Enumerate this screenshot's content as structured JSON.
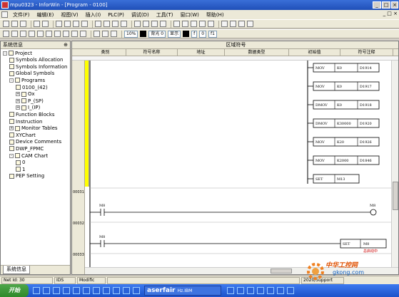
{
  "window": {
    "title": "mpu0323 - InforWin - [Program - 0100]",
    "controls": [
      "_",
      "□",
      "×"
    ]
  },
  "menu": {
    "items": [
      "文件(F)",
      "编辑(E)",
      "视图(V)",
      "插入(I)",
      "PLC(P)",
      "调试(D)",
      "工具(T)",
      "窗口(W)",
      "帮助(H)"
    ],
    "mdi_controls": "_ □ ×"
  },
  "toolbar2": {
    "combo1": "10",
    "combo2": "0",
    "label_step": "10%",
    "label_a": "背光 0",
    "label_b": "显示",
    "label_c": "f",
    "label_d": "0",
    "label_e": "f1"
  },
  "left_panel": {
    "title": "系统信息",
    "pin": "⊕",
    "tab": "系统信息",
    "tree": [
      {
        "label": "Project",
        "level": 0,
        "toggle": "-"
      },
      {
        "label": "Symbols Allocation",
        "level": 1
      },
      {
        "label": "Symbols Information",
        "level": 1
      },
      {
        "label": "Global Symbols",
        "level": 1
      },
      {
        "label": "Programs",
        "level": 1,
        "toggle": "-"
      },
      {
        "label": "0100_(42)",
        "level": 2
      },
      {
        "label": "Ox",
        "level": 2,
        "toggle": "+"
      },
      {
        "label": "P_(SP)",
        "level": 2,
        "toggle": "+"
      },
      {
        "label": "I_(IP)",
        "level": 2,
        "toggle": "+"
      },
      {
        "label": "Function Blocks",
        "level": 1
      },
      {
        "label": "Instruction",
        "level": 1
      },
      {
        "label": "Monitor Tables",
        "level": 1,
        "toggle": "+"
      },
      {
        "label": "XYChart",
        "level": 1
      },
      {
        "label": "Device Comments",
        "level": 1
      },
      {
        "label": "DWP_FPMC",
        "level": 1
      },
      {
        "label": "CAM Chart",
        "level": 1,
        "toggle": "-"
      },
      {
        "label": "0",
        "level": 2
      },
      {
        "label": "1",
        "level": 2
      },
      {
        "label": "PEP Setting",
        "level": 1
      }
    ]
  },
  "editor": {
    "header_title": "区域符号",
    "columns": [
      "类别",
      "符号名称",
      "地址",
      "数据类型",
      "初始值",
      "符号注释"
    ],
    "rung_numbers": [
      "00031",
      "00032",
      "00033"
    ],
    "instructions": [
      {
        "op": "MOV",
        "src": "K0",
        "dst": "D1914"
      },
      {
        "op": "MOV",
        "src": "K0",
        "dst": "D1917"
      },
      {
        "op": "DMOV",
        "src": "K0",
        "dst": "D1918"
      },
      {
        "op": "DMOV",
        "src": "K30000",
        "dst": "D1920"
      },
      {
        "op": "MOV",
        "src": "K20",
        "dst": "D1926"
      },
      {
        "op": "MOV",
        "src": "K2000",
        "dst": "D1846"
      },
      {
        "op": "SET",
        "src": "M13",
        "dst": ""
      }
    ],
    "rung31": {
      "contact": "M8",
      "coil": "M8"
    },
    "rung32": {
      "contact": "M8",
      "set_op": "SET",
      "set_dst": "M8",
      "set_comment": "总启动中"
    }
  },
  "statusbar": {
    "cells": [
      "Net Id: 30",
      "IDS",
      "Modific",
      "2020/Support"
    ]
  },
  "taskbar": {
    "start": "开始",
    "task_label": "aserfair",
    "task_caption": "Hz.IBM"
  },
  "watermark": {
    "brand": "中华工控网",
    "url": "gkong.com"
  }
}
